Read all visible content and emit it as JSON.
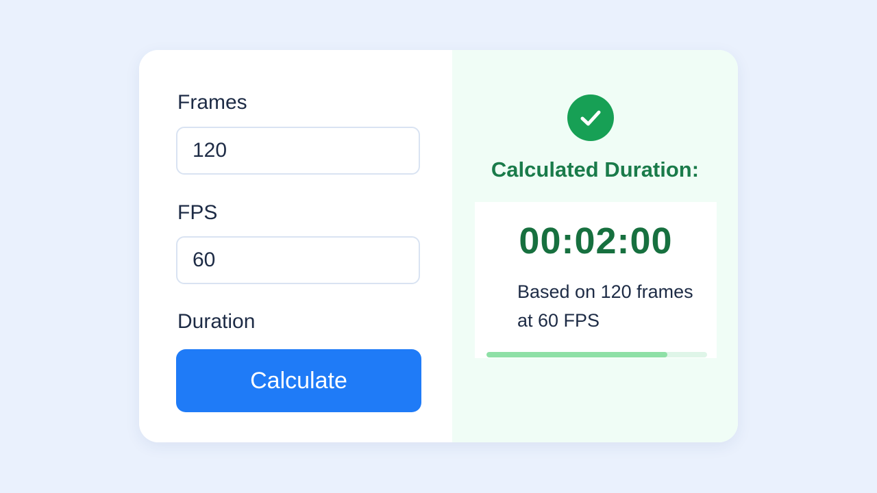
{
  "form": {
    "frames_label": "Frames",
    "frames_value": "120",
    "fps_label": "FPS",
    "fps_value": "60",
    "duration_label": "Duration",
    "calculate_label": "Calculate"
  },
  "result": {
    "status_icon": "check-icon",
    "title": "Calculated Duration:",
    "duration": "00:02:00",
    "basis_line1": "Based on 120 frames",
    "basis_line2": "at 60 FPS",
    "progress_percent": 82
  },
  "colors": {
    "background": "#eaf1fd",
    "accent_blue": "#1f7bf7",
    "success_green": "#17a055",
    "result_text_green": "#17703f",
    "progress_fill": "#8ee0a6"
  }
}
